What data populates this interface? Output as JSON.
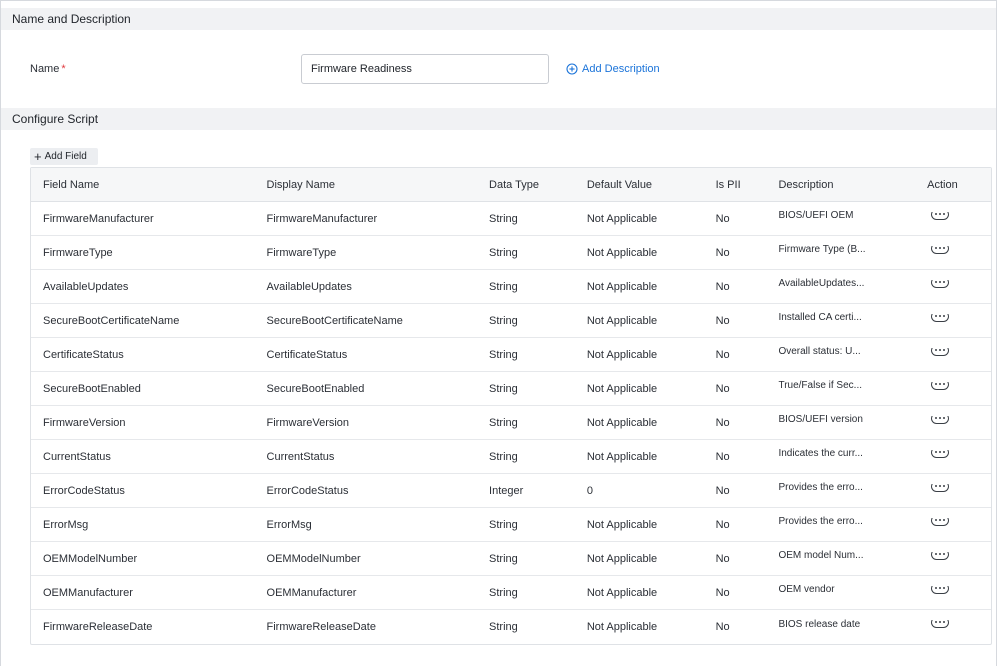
{
  "sections": {
    "name_description": "Name and Description",
    "configure_script": "Configure Script"
  },
  "name_field": {
    "label": "Name",
    "required_mark": "*",
    "value": "Firmware Readiness"
  },
  "add_description": {
    "label": "Add Description",
    "icon": "plus-circle-icon"
  },
  "add_field": {
    "label": "Add Field",
    "icon": "+"
  },
  "table": {
    "headers": [
      "Field Name",
      "Display Name",
      "Data Type",
      "Default Value",
      "Is PII",
      "Description",
      "Action"
    ],
    "rows": [
      [
        "FirmwareManufacturer",
        "FirmwareManufacturer",
        "String",
        "Not Applicable",
        "No",
        "BIOS/UEFI OEM"
      ],
      [
        "FirmwareType",
        "FirmwareType",
        "String",
        "Not Applicable",
        "No",
        "Firmware Type (B..."
      ],
      [
        "AvailableUpdates",
        "AvailableUpdates",
        "String",
        "Not Applicable",
        "No",
        "AvailableUpdates..."
      ],
      [
        "SecureBootCertificateName",
        "SecureBootCertificateName",
        "String",
        "Not Applicable",
        "No",
        "Installed CA certi..."
      ],
      [
        "CertificateStatus",
        "CertificateStatus",
        "String",
        "Not Applicable",
        "No",
        "Overall status: U..."
      ],
      [
        "SecureBootEnabled",
        "SecureBootEnabled",
        "String",
        "Not Applicable",
        "No",
        "True/False if Sec..."
      ],
      [
        "FirmwareVersion",
        "FirmwareVersion",
        "String",
        "Not Applicable",
        "No",
        "BIOS/UEFI version"
      ],
      [
        "CurrentStatus",
        "CurrentStatus",
        "String",
        "Not Applicable",
        "No",
        "Indicates the curr..."
      ],
      [
        "ErrorCodeStatus",
        "ErrorCodeStatus",
        "Integer",
        "0",
        "No",
        "Provides the erro..."
      ],
      [
        "ErrorMsg",
        "ErrorMsg",
        "String",
        "Not Applicable",
        "No",
        "Provides the erro..."
      ],
      [
        "OEMModelNumber",
        "OEMModelNumber",
        "String",
        "Not Applicable",
        "No",
        "OEM model Num..."
      ],
      [
        "OEMManufacturer",
        "OEMManufacturer",
        "String",
        "Not Applicable",
        "No",
        "OEM vendor"
      ],
      [
        "FirmwareReleaseDate",
        "FirmwareReleaseDate",
        "String",
        "Not Applicable",
        "No",
        "BIOS release date"
      ]
    ],
    "action_icon": "more-options-icon"
  },
  "colors": {
    "accent": "#1a73d9",
    "required": "#e0393e",
    "section_bg": "#f1f2f4"
  }
}
